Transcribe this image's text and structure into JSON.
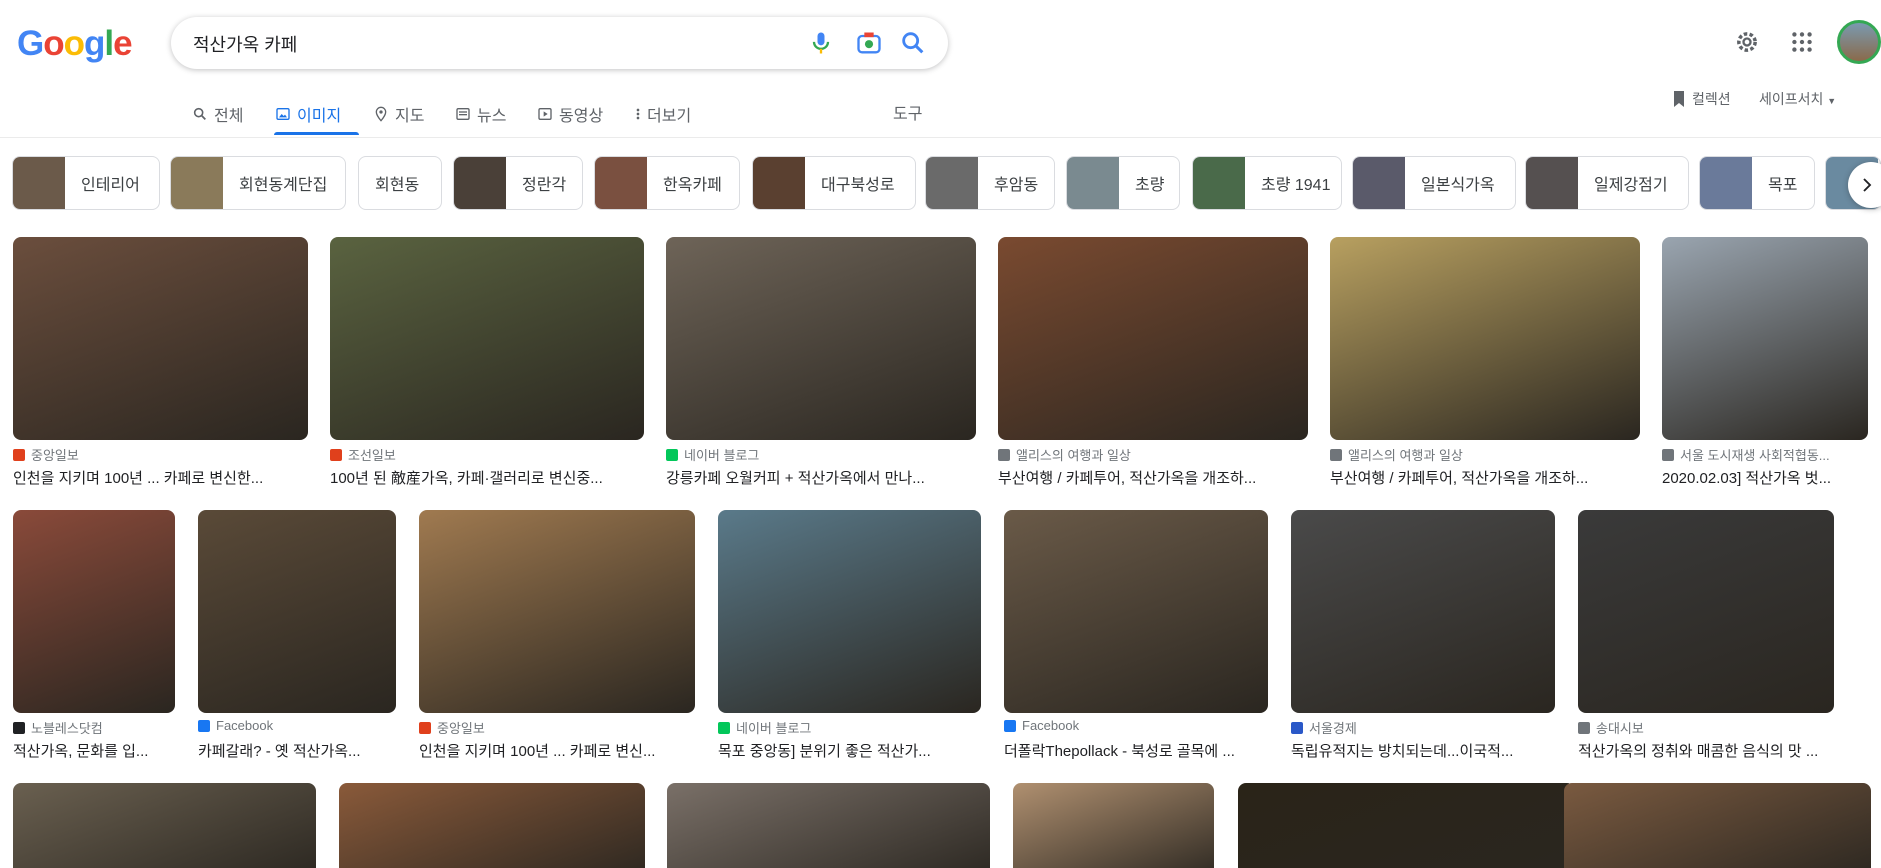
{
  "logo": {
    "letters": [
      "G",
      "o",
      "o",
      "g",
      "l",
      "e"
    ],
    "colors": [
      "#4285F4",
      "#EA4335",
      "#FBBC05",
      "#4285F4",
      "#34A853",
      "#EA4335"
    ]
  },
  "search": {
    "query": "적산가옥 카페"
  },
  "tabs": [
    {
      "label": "전체",
      "icon": "search-icon"
    },
    {
      "label": "이미지",
      "icon": "image-icon"
    },
    {
      "label": "지도",
      "icon": "map-pin-icon"
    },
    {
      "label": "뉴스",
      "icon": "news-icon"
    },
    {
      "label": "동영상",
      "icon": "video-icon"
    },
    {
      "label": "더보기",
      "icon": "more-vert-icon"
    }
  ],
  "tools_label": "도구",
  "collections_label": "컬렉션",
  "safesearch_label": "세이프서치",
  "chips": [
    {
      "label": "인테리어",
      "color": "#6b5a4a"
    },
    {
      "label": "회현동계단집",
      "color": "#8a7a5a"
    },
    {
      "label": "회현동",
      "color": ""
    },
    {
      "label": "정란각",
      "color": "#4a4038"
    },
    {
      "label": "한옥카페",
      "color": "#7a5040"
    },
    {
      "label": "대구북성로",
      "color": "#5a4030"
    },
    {
      "label": "후암동",
      "color": "#6a6a6a"
    },
    {
      "label": "초량",
      "color": "#7a8a90"
    },
    {
      "label": "초량 1941",
      "color": "#4a6a4a"
    },
    {
      "label": "일본식가옥",
      "color": "#5a5a6a"
    },
    {
      "label": "일제강점기",
      "color": "#555050"
    },
    {
      "label": "목포",
      "color": "#6a7a9a"
    }
  ],
  "accent": "#1a73e8",
  "results": [
    {
      "source": "중앙일보",
      "title": "인천을 지키며 100년 ... 카페로 변신한...",
      "color": "#6b4e3d",
      "favicon": "#e0401c"
    },
    {
      "source": "조선일보",
      "title": "100년 된 敵産가옥, 카페·갤러리로 변신중...",
      "color": "#5a6340",
      "favicon": "#e0401c"
    },
    {
      "source": "네이버 블로그",
      "title": "강릉카페 오월커피 + 적산가옥에서 만나...",
      "color": "#6e6458",
      "favicon": "#03c75a"
    },
    {
      "source": "앨리스의 여행과 일상",
      "title": "부산여행 / 카페투어, 적산가옥을 개조하...",
      "color": "#7a4a30",
      "favicon": "#70757a"
    },
    {
      "source": "앨리스의 여행과 일상",
      "title": "부산여행 / 카페투어, 적산가옥을 개조하...",
      "color": "#b8a060",
      "favicon": "#70757a"
    },
    {
      "source": "서울 도시재생 사회적협동...",
      "title": "2020.02.03] 적산가옥 벗...",
      "color": "#9aa5b0",
      "favicon": "#70757a"
    },
    {
      "source": "노블레스닷컴",
      "title": "적산가옥, 문화를 입...",
      "color": "#8a4a3a",
      "favicon": "#202124"
    },
    {
      "source": "Facebook",
      "title": "카페갈래? - 옛 적산가옥...",
      "color": "#5a4a38",
      "favicon": "#1877f2"
    },
    {
      "source": "중앙일보",
      "title": "인천을 지키며 100년 ... 카페로 변신...",
      "color": "#a07a50",
      "favicon": "#e0401c"
    },
    {
      "source": "네이버 블로그",
      "title": "목포 중앙동] 분위기 좋은 적산가...",
      "color": "#5a7a8a",
      "favicon": "#03c75a"
    },
    {
      "source": "Facebook",
      "title": "더폴락Thepollack - 북성로 골목에 ...",
      "color": "#6a5a48",
      "favicon": "#1877f2"
    },
    {
      "source": "서울경제",
      "title": "독립유적지는 방치되는데...이국적...",
      "color": "#4a4a4a",
      "favicon": "#2a58c8"
    },
    {
      "source": "송대시보",
      "title": "적산가옥의 정취와 매콤한 음식의 맛 ...",
      "color": "#3a3a3a",
      "favicon": "#70757a"
    },
    {
      "source": "",
      "title": "",
      "color": "#6a6050",
      "favicon": ""
    },
    {
      "source": "",
      "title": "",
      "color": "#8a5a3a",
      "favicon": ""
    },
    {
      "source": "",
      "title": "",
      "color": "#7a7068",
      "favicon": ""
    },
    {
      "source": "",
      "title": "",
      "color": "#b09070",
      "favicon": ""
    },
    {
      "source": "",
      "title": "",
      "color": "#2a2418",
      "favicon": ""
    },
    {
      "source": "",
      "title": "",
      "color": "#7a5a40",
      "favicon": ""
    }
  ]
}
